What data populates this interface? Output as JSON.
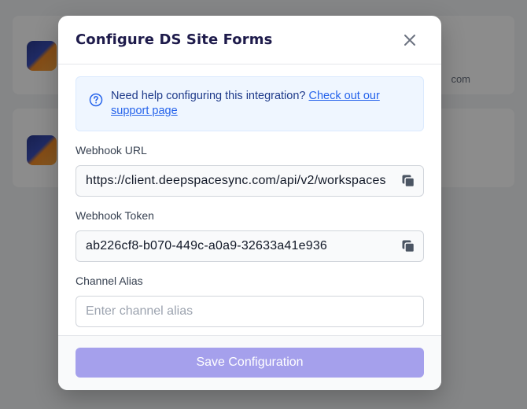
{
  "background": {
    "faint_text": "com"
  },
  "modal": {
    "title": "Configure DS Site Forms",
    "help": {
      "text": "Need help configuring this integration? ",
      "link_text": "Check out our support page"
    },
    "fields": {
      "webhook_url": {
        "label": "Webhook URL",
        "value": "https://client.deepspacesync.com/api/v2/workspaces"
      },
      "webhook_token": {
        "label": "Webhook Token",
        "value": "ab226cf8-b070-449c-a0a9-32633a41e936"
      },
      "channel_alias": {
        "label": "Channel Alias",
        "placeholder": "Enter channel alias",
        "value": ""
      }
    },
    "save_label": "Save Configuration"
  },
  "icons": {
    "close": "close-icon",
    "help": "question-circle-icon",
    "copy": "copy-icon"
  },
  "colors": {
    "title": "#1e1b4b",
    "link": "#2563eb",
    "help_bg": "#eff6ff",
    "save_button": "#a5a0ec"
  }
}
